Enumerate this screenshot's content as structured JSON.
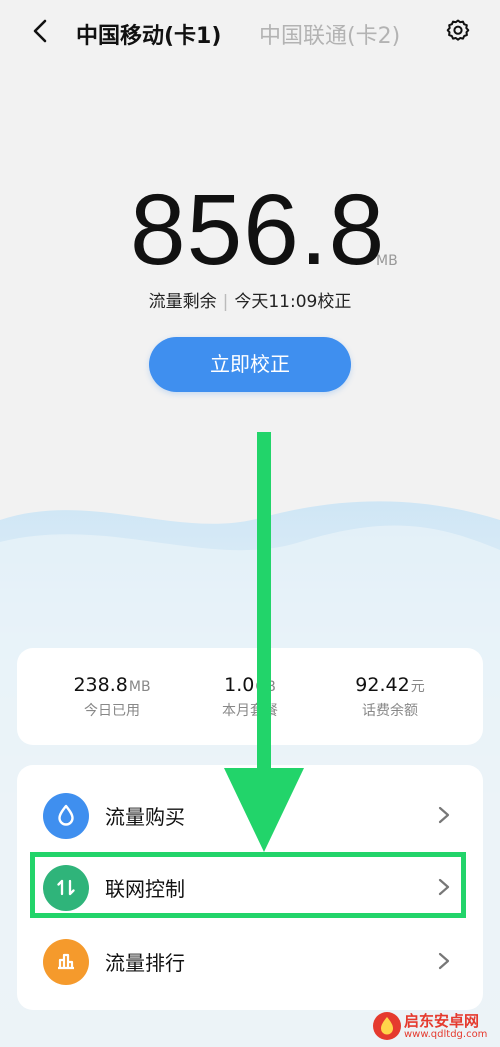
{
  "header": {
    "tab_active": "中国移动(卡1)",
    "tab_inactive": "中国联通(卡2)",
    "back_icon": "chevron-left-icon",
    "settings_icon": "gear-icon"
  },
  "usage": {
    "remaining_value": "856.8",
    "unit": "MB",
    "remaining_label": "流量剩余",
    "calibrated_text": "今天11:09校正"
  },
  "calibrate_button": {
    "label": "立即校正"
  },
  "stats": [
    {
      "value": "238.8",
      "unit": "MB",
      "label": "今日已用"
    },
    {
      "value": "1.0",
      "unit": "GB",
      "label": "本月套餐"
    },
    {
      "value": "92.42",
      "unit": "元",
      "label": "话费余额"
    }
  ],
  "menu": [
    {
      "label": "流量购买",
      "icon": "water-drop-icon",
      "color": "#3f8fef"
    },
    {
      "label": "联网控制",
      "icon": "up-down-arrows-icon",
      "color": "#2fb47a"
    },
    {
      "label": "流量排行",
      "icon": "bar-chart-icon",
      "color": "#f59a2c"
    }
  ],
  "colors": {
    "accent_blue": "#3f8fef",
    "annotation_green": "#22d46a",
    "wave_blue": "#cfe6f5"
  },
  "watermark": {
    "name": "启东安卓网",
    "url": "www.qdltdg.com"
  }
}
